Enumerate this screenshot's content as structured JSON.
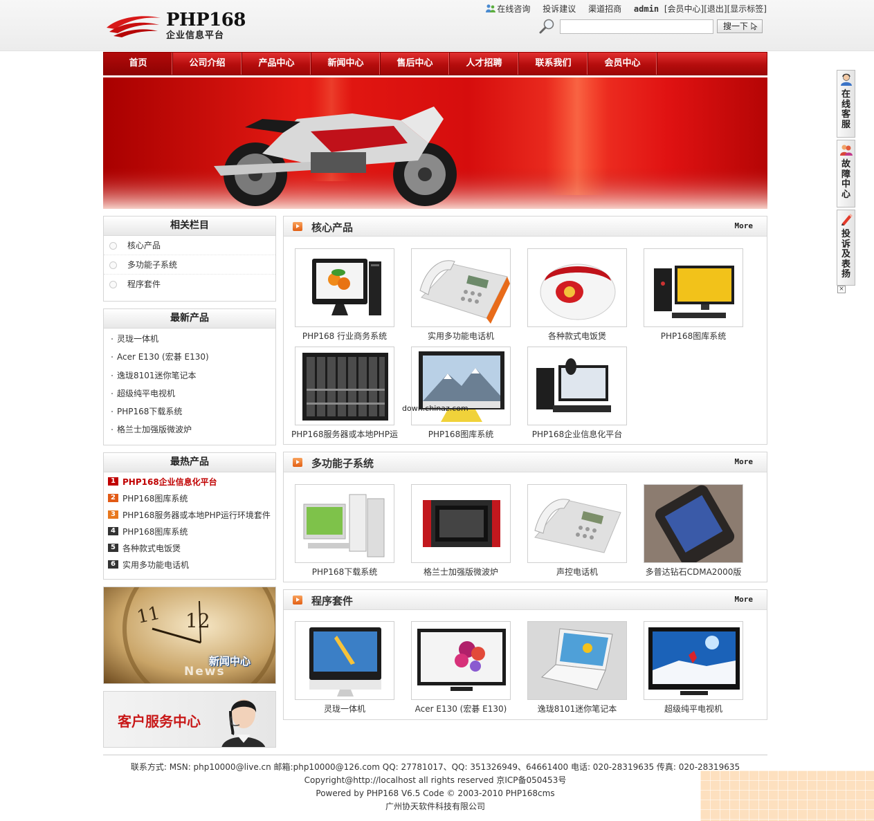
{
  "header": {
    "logo_title": "PHP168",
    "logo_subtitle": "企业信息平台",
    "links": {
      "online_consult": "在线咨询",
      "complaint": "投诉建议",
      "channel": "渠道招商",
      "user": "admin",
      "member_center": "[会员中心]",
      "logout": "[退出]",
      "show_tags": "[显示标签]"
    },
    "search": {
      "placeholder": "",
      "button_label": "搜一下"
    }
  },
  "nav": {
    "items": [
      "首页",
      "公司介绍",
      "产品中心",
      "新闻中心",
      "售后中心",
      "人才招聘",
      "联系我们",
      "会员中心"
    ],
    "active_index": 0
  },
  "sidebar": {
    "related": {
      "title": "相关栏目",
      "items": [
        "核心产品",
        "多功能子系统",
        "程序套件"
      ]
    },
    "newest": {
      "title": "最新产品",
      "items": [
        "灵珑一体机",
        "Acer E130 (宏碁 E130)",
        "逸珑8101迷你笔记本",
        "超级纯平电视机",
        "PHP168下载系统",
        "格兰士加强版微波炉"
      ]
    },
    "hottest": {
      "title": "最热产品",
      "items": [
        {
          "rank": "1",
          "label": "PHP168企业信息化平台"
        },
        {
          "rank": "2",
          "label": "PHP168图库系统"
        },
        {
          "rank": "3",
          "label": "PHP168服务器或本地PHP运行环境套件"
        },
        {
          "rank": "4",
          "label": "PHP168图库系统"
        },
        {
          "rank": "5",
          "label": "各种款式电饭煲"
        },
        {
          "rank": "6",
          "label": "实用多功能电话机"
        }
      ]
    },
    "news_banner": {
      "title": "新闻中心",
      "subtitle": "News"
    },
    "service_banner": {
      "title": "客户服务中心"
    }
  },
  "panels": {
    "core": {
      "title": "核心产品",
      "more": "More",
      "products": [
        "PHP168 行业商务系统",
        "实用多功能电话机",
        "各种款式电饭煲",
        "PHP168图库系统",
        "PHP168服务器或本地PHP运",
        "PHP168图库系统",
        "PHP168企业信息化平台"
      ]
    },
    "multi": {
      "title": "多功能子系统",
      "more": "More",
      "products": [
        "PHP168下载系统",
        "格兰士加强版微波炉",
        "声控电话机",
        "多普达钻石CDMA2000版"
      ]
    },
    "suite": {
      "title": "程序套件",
      "more": "More",
      "products": [
        "灵珑一体机",
        "Acer E130 (宏碁 E130)",
        "逸珑8101迷你笔记本",
        "超级纯平电视机"
      ]
    }
  },
  "watermark": "down.chinaz.com",
  "footer": {
    "line1": "联系方式: MSN: php10000@live.cn 邮箱:php10000@126.com QQ: 27781017、QQ: 351326949、64661400 电话: 020-28319635 传真: 020-28319635",
    "line2": "Copyright@http://localhost all rights reserved 京ICP备050453号",
    "line3": "Powered by PHP168 V6.5 Code © 2003-2010 PHP168cms",
    "line4": "广州协天软件科技有限公司"
  },
  "floatbar": {
    "buttons": [
      "在线客服",
      "故障中心",
      "投诉及表扬"
    ],
    "close": "×"
  },
  "colors": {
    "nav_red": "#c01010",
    "title_red": "#c00000",
    "accent_orange": "#e86a1f"
  }
}
